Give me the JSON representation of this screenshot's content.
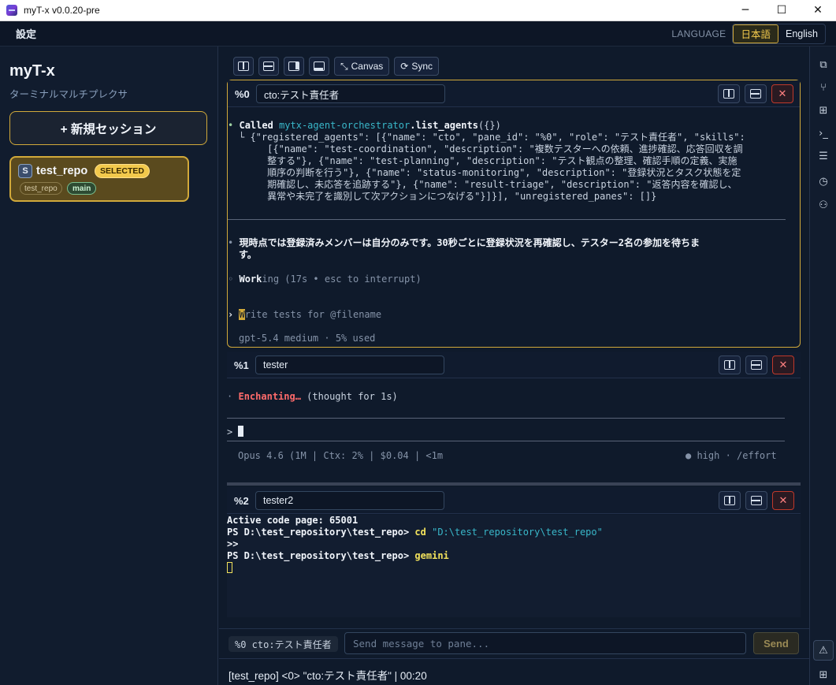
{
  "window": {
    "title": "myT-x v0.0.20-pre",
    "minimize_glyph": "─",
    "maximize_glyph": "☐",
    "close_glyph": "✕"
  },
  "menubar": {
    "settings_label": "設定",
    "language_label": "LANGUAGE",
    "lang_ja": "日本語",
    "lang_en": "English",
    "active_lang": "ja"
  },
  "sidebar": {
    "brand": "myT-x",
    "subtitle": "ターミナルマルチプレクサ",
    "new_session_label": "+ 新規セッション",
    "sessions": [
      {
        "badge": "S",
        "name": "test_repo",
        "selected_label": "SELECTED",
        "repo_tag": "test_repo",
        "branch_tag": "main"
      }
    ]
  },
  "toolbar": {
    "canvas_label": "Canvas",
    "sync_label": "Sync"
  },
  "panes": [
    {
      "id": "%0",
      "title": "cto:テスト責任者",
      "lines": {
        "l1_called": "Called",
        "l1_tool": "mytx-agent-orchestrator",
        "l1_method": ".list_agents",
        "l1_args": "({})",
        "r1": "└ {\"registered_agents\": [{\"name\": \"cto\", \"pane_id\": \"%0\", \"role\": \"テスト責任者\", \"skills\":",
        "r2": "     [{\"name\": \"test-coordination\", \"description\": \"複数テスターへの依頼、進捗確認、応答回収を調",
        "r3": "     整する\"}, {\"name\": \"test-planning\", \"description\": \"テスト観点の整理、確認手順の定義、実施",
        "r4": "     順序の判断を行う\"}, {\"name\": \"status-monitoring\", \"description\": \"登録状況とタスク状態を定",
        "r5": "     期確認し、未応答を追跡する\"}, {\"name\": \"result-triage\", \"description\": \"返答内容を確認し、",
        "r6": "     異常や未完了を識別して次アクションにつなげる\"}]}], \"unregistered_panes\": []}",
        "msg1": "現時点では登録済みメンバーは自分のみです。30秒ごとに登録状況を再確認し、テスター2名の参加を待ちま",
        "msg2": "す。",
        "work_bold": "Work",
        "work_rest": "ing (17s • esc to interrupt)",
        "prompt_cursor_char": "W",
        "prompt_rest": "rite tests for @filename",
        "model": "gpt-5.4 medium · 5% used"
      }
    },
    {
      "id": "%1",
      "title": "tester",
      "lines": {
        "thinking_word": "Enchanting…",
        "thinking_rest": " (thought for 1s)",
        "prompt": ">",
        "status_left": "Opus 4.6 (1M | Ctx: 2% | $0.04 | <1m",
        "status_right": "● high · /effort"
      }
    },
    {
      "id": "%2",
      "title": "tester2",
      "lines": {
        "l1": "Active code page: 65001",
        "l2_prompt": "PS D:\\test_repository\\test_repo> ",
        "l2_cmd": "cd",
        "l2_arg": " \"D:\\test_repository\\test_repo\"",
        "l3": ">>",
        "l4_prompt": "PS D:\\test_repository\\test_repo> ",
        "l4_cmd": "gemini"
      }
    }
  ],
  "send_bar": {
    "target": "%0 cto:テスト責任者",
    "placeholder": "Send message to pane...",
    "send_label": "Send"
  },
  "status": {
    "text": "[test_repo] <0> \"cto:テスト責任者\" | 00:20"
  },
  "colors": {
    "accent": "#d1a93a",
    "background": "#0f1a2b",
    "teal": "#39b7c9",
    "warning_red": "#ff6b6b"
  }
}
